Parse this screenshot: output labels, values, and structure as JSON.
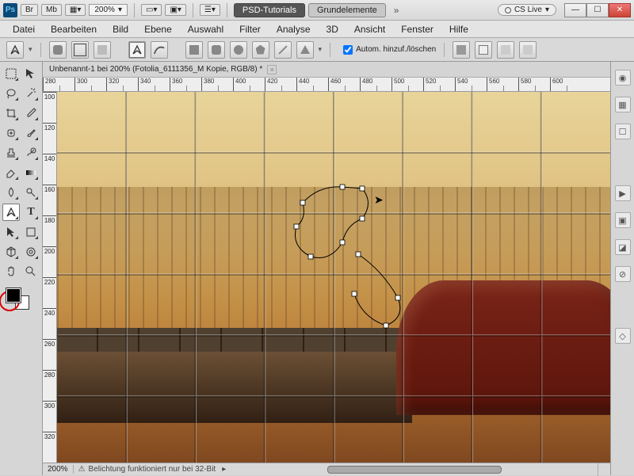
{
  "titlebar": {
    "app": "Ps",
    "chips": [
      "Br",
      "Mb"
    ],
    "zoom_dd": "200%",
    "tabs": {
      "active": "PSD-Tutorials",
      "inactive": "Grundelemente"
    },
    "cslive": "CS Live"
  },
  "menu": [
    "Datei",
    "Bearbeiten",
    "Bild",
    "Ebene",
    "Auswahl",
    "Filter",
    "Analyse",
    "3D",
    "Ansicht",
    "Fenster",
    "Hilfe"
  ],
  "optbar": {
    "auto_checkbox": "Autom. hinzuf./löschen"
  },
  "doctab": {
    "title": "Unbenannt-1 bei 200% (Fotolia_6111356_M Kopie, RGB/8) *"
  },
  "ruler_h": [
    "280",
    "300",
    "320",
    "340",
    "360",
    "380",
    "400",
    "420",
    "440",
    "460",
    "480",
    "500",
    "520",
    "540",
    "560",
    "580",
    "600"
  ],
  "ruler_v": [
    "100",
    "120",
    "140",
    "160",
    "180",
    "200",
    "220",
    "240",
    "260",
    "280",
    "300",
    "320"
  ],
  "status": {
    "zoom": "200%",
    "message": "Belichtung funktioniert nur bei 32-Bit"
  },
  "tools": [
    "move",
    "marquee",
    "lasso",
    "wand",
    "crop",
    "eyedropper",
    "heal",
    "brush",
    "stamp",
    "history",
    "eraser",
    "gradient",
    "blur",
    "dodge",
    "pen",
    "type",
    "path-sel",
    "shape",
    "hand",
    "zoom"
  ],
  "panel_icons": [
    "color",
    "swatch",
    "3d",
    "mask",
    "styles",
    "play",
    "layers",
    "fx",
    "paths",
    "channels"
  ]
}
